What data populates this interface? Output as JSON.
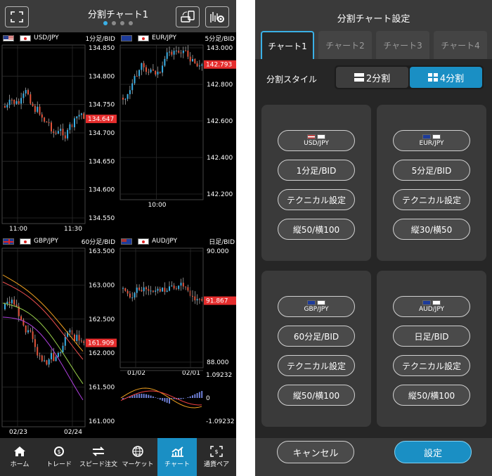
{
  "left": {
    "title": "分割チャート1",
    "page_dots": 4,
    "active_dot": 0,
    "charts": [
      {
        "symbol": "USD/JPY",
        "timeframe": "1分足/BID",
        "flag": "us-jp-flag-icon",
        "yticks": [
          "134.850",
          "134.800",
          "134.750",
          "134.700",
          "134.650",
          "134.600",
          "134.550"
        ],
        "last": "134.647",
        "xticks": [
          "11:00",
          "11:30"
        ]
      },
      {
        "symbol": "EUR/JPY",
        "timeframe": "5分足/BID",
        "flag": "eu-jp-flag-icon",
        "yticks": [
          "143.000",
          "142.800",
          "142.600",
          "142.400",
          "142.200"
        ],
        "last": "142.793",
        "xticks": [
          "10:00"
        ]
      },
      {
        "symbol": "GBP/JPY",
        "timeframe": "60分足/BID",
        "flag": "gb-jp-flag-icon",
        "yticks": [
          "163.500",
          "163.000",
          "162.500",
          "162.000",
          "161.500",
          "161.000"
        ],
        "last": "161.909",
        "xticks": [
          "02/23",
          "02/24"
        ]
      },
      {
        "symbol": "AUD/JPY",
        "timeframe": "日足/BID",
        "flag": "au-jp-flag-icon",
        "yticks": [
          "90.000",
          "88.000"
        ],
        "last": "91.867",
        "subticks": [
          "1.09232",
          "0",
          "-1.09232"
        ],
        "xticks": [
          "01/02",
          "02/01"
        ]
      }
    ],
    "nav": [
      {
        "label": "ホーム",
        "icon": "home-icon"
      },
      {
        "label": "トレード",
        "icon": "trade-icon"
      },
      {
        "label": "スピード注文",
        "icon": "speed-order-icon"
      },
      {
        "label": "マーケット",
        "icon": "globe-icon"
      },
      {
        "label": "チャート",
        "icon": "chart-icon"
      },
      {
        "label": "通貨ペア",
        "icon": "currency-pair-icon"
      }
    ],
    "active_nav": 4
  },
  "right": {
    "title": "分割チャート設定",
    "tabs": [
      "チャート1",
      "チャート2",
      "チャート3",
      "チャート4"
    ],
    "active_tab": 0,
    "style_label": "分割スタイル",
    "style_options": [
      "2分割",
      "4分割"
    ],
    "active_style": 1,
    "cards": [
      {
        "pair": "USD/JPY",
        "timeframe": "1分足/BID",
        "technical": "テクニカル設定",
        "size": "縦50/横100"
      },
      {
        "pair": "EUR/JPY",
        "timeframe": "5分足/BID",
        "technical": "テクニカル設定",
        "size": "縦30/横50"
      },
      {
        "pair": "GBP/JPY",
        "timeframe": "60分足/BID",
        "technical": "テクニカル設定",
        "size": "縦50/横100"
      },
      {
        "pair": "AUD/JPY",
        "timeframe": "日足/BID",
        "technical": "テクニカル設定",
        "size": "縦50/横100"
      }
    ],
    "cancel_label": "キャンセル",
    "ok_label": "設定",
    "accent": "#1a8fc4",
    "up_color": "#3ab0e6",
    "down_color": "#e2533a"
  }
}
